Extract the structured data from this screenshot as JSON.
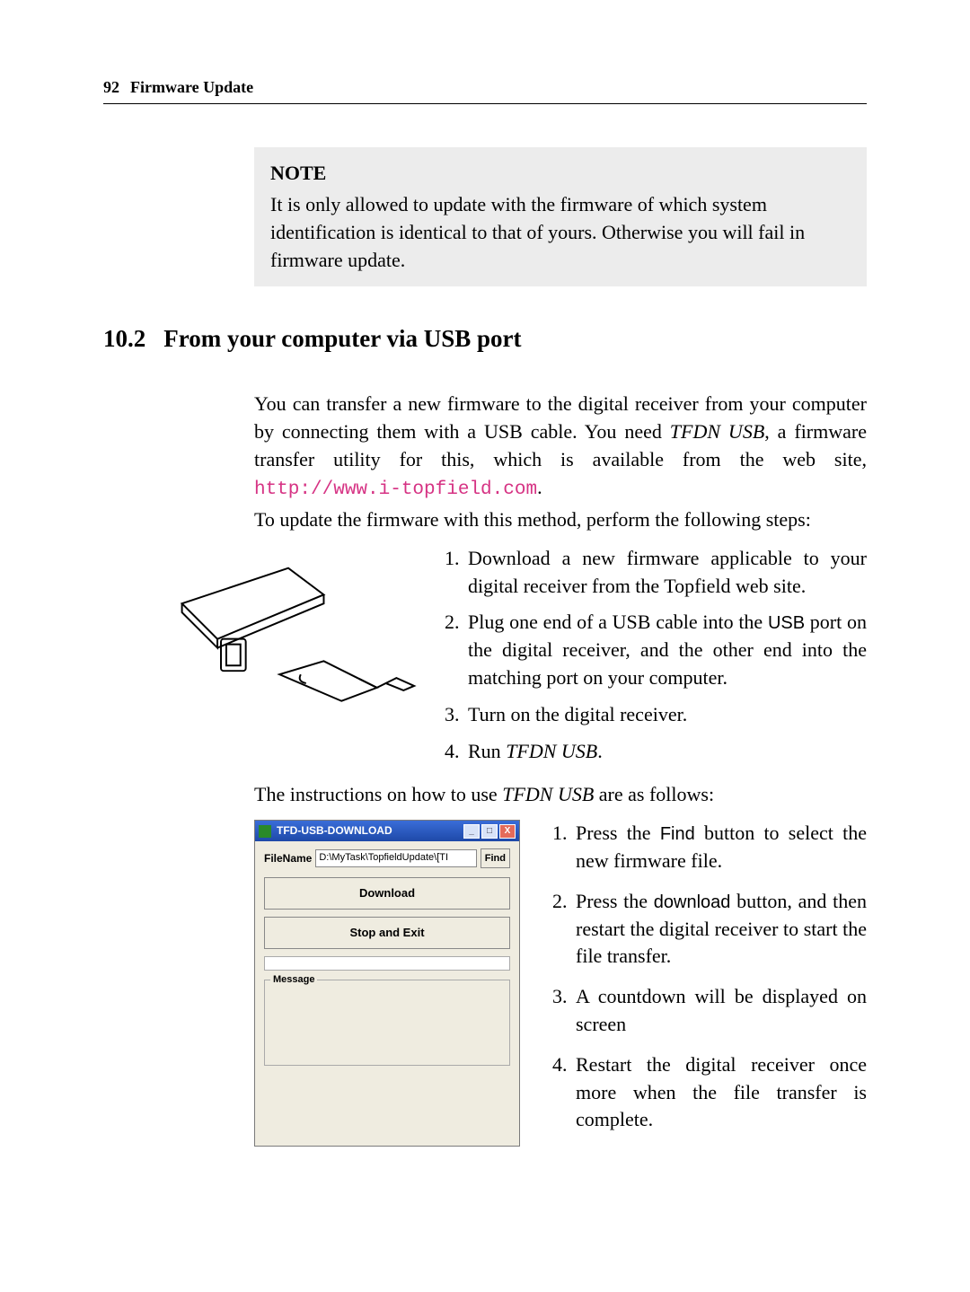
{
  "header": {
    "page_number": "92",
    "title": "Firmware Update"
  },
  "note": {
    "label": "NOTE",
    "body": "It is only allowed to update with the firmware of which system identification is identical to that of yours. Otherwise you will fail in firmware update."
  },
  "section": {
    "number": "10.2",
    "title": "From your computer via USB port"
  },
  "intro": {
    "p1_pre": "You can transfer a new firmware to the digital receiver from your computer by connecting them with a USB cable. You need ",
    "tfdn": "TFDN USB",
    "p1_post": ", a firmware transfer utility for this, which is available from the web site, ",
    "url": "http://www.i-topfield.com",
    "period": ".",
    "p2": "To update the firmware with this method, perform the following steps:"
  },
  "steps_a": {
    "item1": "Download a new firmware applicable to your digital receiver from the Topfield web site.",
    "item2_pre": "Plug one end of a USB cable into the ",
    "item2_usb": "USB",
    "item2_post": " port on the digital receiver, and the other end into the matching port on your computer.",
    "item3": "Turn on the digital receiver.",
    "item4_pre": "Run ",
    "item4_tfdn": "TFDN USB",
    "item4_post": "."
  },
  "mid": {
    "pre": "The instructions on how to use ",
    "tfdn": "TFDN USB",
    "post": " are as follows:"
  },
  "app": {
    "title": "TFD-USB-DOWNLOAD",
    "file_label": "FileName",
    "file_value": "D:\\MyTask\\TopfieldUpdate\\[TI",
    "find": "Find",
    "download": "Download",
    "stop": "Stop and Exit",
    "message": "Message"
  },
  "steps_b": {
    "item1_pre": "Press the ",
    "item1_find": "Find",
    "item1_post": " button to select the new firmware file.",
    "item2_pre": "Press the ",
    "item2_dl": "download",
    "item2_post": " button, and then restart the digital receiver to start the file transfer.",
    "item3": "A countdown will be displayed on screen",
    "item4": "Restart the digital receiver once more when the file transfer is complete."
  }
}
